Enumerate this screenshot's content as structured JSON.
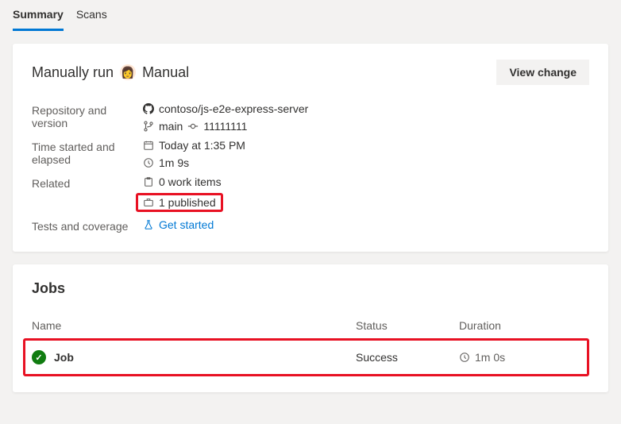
{
  "tabs": [
    {
      "label": "Summary",
      "active": true
    },
    {
      "label": "Scans",
      "active": false
    }
  ],
  "summary": {
    "title_prefix": "Manually run",
    "title_suffix": "Manual",
    "view_change": "View change",
    "details": {
      "repo_label": "Repository and version",
      "repo": "contoso/js-e2e-express-server",
      "branch": "main",
      "commit": "11111111",
      "time_label": "Time started and elapsed",
      "started": "Today at 1:35 PM",
      "elapsed": "1m 9s",
      "related_label": "Related",
      "work_items": "0 work items",
      "published": "1 published",
      "tests_label": "Tests and coverage",
      "tests_link": "Get started"
    }
  },
  "jobs": {
    "title": "Jobs",
    "columns": {
      "name": "Name",
      "status": "Status",
      "duration": "Duration"
    },
    "rows": [
      {
        "name": "Job",
        "status": "Success",
        "duration": "1m 0s"
      }
    ]
  }
}
